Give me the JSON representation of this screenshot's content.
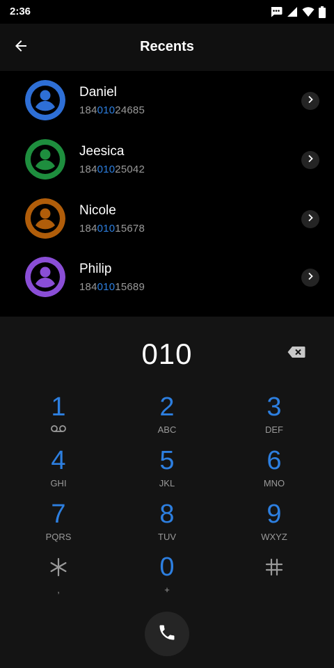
{
  "status_bar": {
    "time": "2:36",
    "icons": [
      "message-icon",
      "signal-icon",
      "wifi-icon",
      "battery-icon"
    ]
  },
  "header": {
    "title": "Recents",
    "back_icon": "arrow-left-icon"
  },
  "recents": [
    {
      "name": "Daniel",
      "number_prefix": "184",
      "number_match": "010",
      "number_suffix": "24685",
      "avatar_color": "#2e6fd6"
    },
    {
      "name": "Jeesica",
      "number_prefix": "184",
      "number_match": "010",
      "number_suffix": "25042",
      "avatar_color": "#1e8e3e"
    },
    {
      "name": "Nicole",
      "number_prefix": "184",
      "number_match": "010",
      "number_suffix": "15678",
      "avatar_color": "#b05d0a"
    },
    {
      "name": "Philip",
      "number_prefix": "184",
      "number_match": "010",
      "number_suffix": "15689",
      "avatar_color": "#8a4ed6"
    }
  ],
  "dialpad": {
    "entered_digits": "010",
    "keys": [
      {
        "digit": "1",
        "letters": ""
      },
      {
        "digit": "2",
        "letters": "ABC"
      },
      {
        "digit": "3",
        "letters": "DEF"
      },
      {
        "digit": "4",
        "letters": "GHI"
      },
      {
        "digit": "5",
        "letters": "JKL"
      },
      {
        "digit": "6",
        "letters": "MNO"
      },
      {
        "digit": "7",
        "letters": "PQRS"
      },
      {
        "digit": "8",
        "letters": "TUV"
      },
      {
        "digit": "9",
        "letters": "WXYZ"
      },
      {
        "digit": "*",
        "letters": ","
      },
      {
        "digit": "0",
        "letters": "+"
      },
      {
        "digit": "#",
        "letters": ""
      }
    ]
  },
  "colors": {
    "accent": "#2d7fe0",
    "secondary_text": "#9a9a9a",
    "dialpad_bg": "#141414"
  }
}
